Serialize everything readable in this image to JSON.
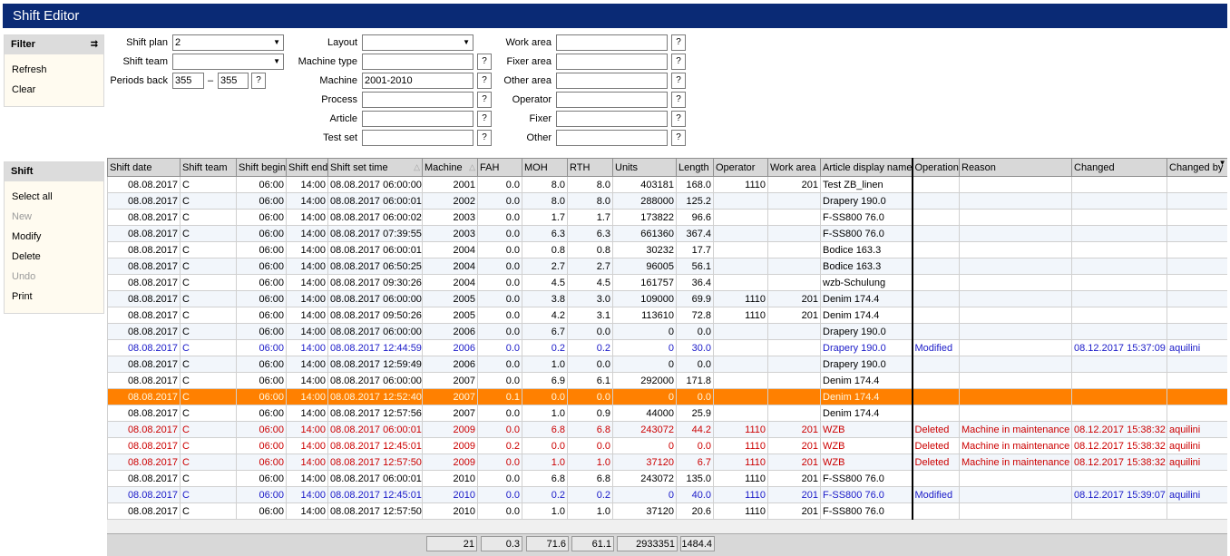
{
  "title": "Shift Editor",
  "filter_panel": {
    "title": "Filter",
    "items": [
      "Refresh",
      "Clear"
    ]
  },
  "shift_panel": {
    "title": "Shift",
    "items": [
      {
        "label": "Select all",
        "enabled": true
      },
      {
        "label": "New",
        "enabled": false
      },
      {
        "label": "Modify",
        "enabled": true
      },
      {
        "label": "Delete",
        "enabled": true
      },
      {
        "label": "Undo",
        "enabled": false
      },
      {
        "label": "Print",
        "enabled": true
      }
    ]
  },
  "filters": {
    "shift_plan": {
      "label": "Shift plan",
      "value": "2"
    },
    "shift_team": {
      "label": "Shift team",
      "value": ""
    },
    "periods_back": {
      "label": "Periods back",
      "from": "355",
      "dash": "–",
      "to": "355"
    },
    "layout": {
      "label": "Layout",
      "value": ""
    },
    "machine_type": {
      "label": "Machine type",
      "value": ""
    },
    "machine": {
      "label": "Machine",
      "value": "2001-2010"
    },
    "process": {
      "label": "Process",
      "value": ""
    },
    "article": {
      "label": "Article",
      "value": ""
    },
    "test_set": {
      "label": "Test set",
      "value": ""
    },
    "work_area": {
      "label": "Work area",
      "value": ""
    },
    "fixer_area": {
      "label": "Fixer area",
      "value": ""
    },
    "other_area": {
      "label": "Other area",
      "value": ""
    },
    "operator": {
      "label": "Operator",
      "value": ""
    },
    "fixer": {
      "label": "Fixer",
      "value": ""
    },
    "other": {
      "label": "Other",
      "value": ""
    },
    "help_button": "?"
  },
  "grid": {
    "columns": [
      "Shift date",
      "Shift team",
      "Shift begin",
      "Shift end",
      "Shift set time",
      "Machine",
      "FAH",
      "MOH",
      "RTH",
      "Units",
      "Length",
      "Operator",
      "Work area",
      "Article display name",
      "Operation",
      "Reason",
      "Changed",
      "Changed by"
    ],
    "sort_indicator": "△",
    "rows": [
      {
        "style": "normal",
        "cells": [
          "08.08.2017",
          "C",
          "06:00",
          "14:00",
          "08.08.2017 06:00:00",
          "2001",
          "0.0",
          "8.0",
          "8.0",
          "403181",
          "168.0",
          "1110",
          "201",
          "Test ZB_linen",
          "",
          "",
          "",
          ""
        ]
      },
      {
        "style": "normal",
        "cells": [
          "08.08.2017",
          "C",
          "06:00",
          "14:00",
          "08.08.2017 06:00:01",
          "2002",
          "0.0",
          "8.0",
          "8.0",
          "288000",
          "125.2",
          "",
          "",
          "Drapery 190.0",
          "",
          "",
          "",
          ""
        ]
      },
      {
        "style": "normal",
        "cells": [
          "08.08.2017",
          "C",
          "06:00",
          "14:00",
          "08.08.2017 06:00:02",
          "2003",
          "0.0",
          "1.7",
          "1.7",
          "173822",
          "96.6",
          "",
          "",
          "F-SS800 76.0",
          "",
          "",
          "",
          ""
        ]
      },
      {
        "style": "normal",
        "cells": [
          "08.08.2017",
          "C",
          "06:00",
          "14:00",
          "08.08.2017 07:39:55",
          "2003",
          "0.0",
          "6.3",
          "6.3",
          "661360",
          "367.4",
          "",
          "",
          "F-SS800 76.0",
          "",
          "",
          "",
          ""
        ]
      },
      {
        "style": "normal",
        "cells": [
          "08.08.2017",
          "C",
          "06:00",
          "14:00",
          "08.08.2017 06:00:01",
          "2004",
          "0.0",
          "0.8",
          "0.8",
          "30232",
          "17.7",
          "",
          "",
          "Bodice 163.3",
          "",
          "",
          "",
          ""
        ]
      },
      {
        "style": "normal",
        "cells": [
          "08.08.2017",
          "C",
          "06:00",
          "14:00",
          "08.08.2017 06:50:25",
          "2004",
          "0.0",
          "2.7",
          "2.7",
          "96005",
          "56.1",
          "",
          "",
          "Bodice 163.3",
          "",
          "",
          "",
          ""
        ]
      },
      {
        "style": "normal",
        "cells": [
          "08.08.2017",
          "C",
          "06:00",
          "14:00",
          "08.08.2017 09:30:26",
          "2004",
          "0.0",
          "4.5",
          "4.5",
          "161757",
          "36.4",
          "",
          "",
          "wzb-Schulung",
          "",
          "",
          "",
          ""
        ]
      },
      {
        "style": "normal",
        "cells": [
          "08.08.2017",
          "C",
          "06:00",
          "14:00",
          "08.08.2017 06:00:00",
          "2005",
          "0.0",
          "3.8",
          "3.0",
          "109000",
          "69.9",
          "1110",
          "201",
          "Denim 174.4",
          "",
          "",
          "",
          ""
        ]
      },
      {
        "style": "normal",
        "cells": [
          "08.08.2017",
          "C",
          "06:00",
          "14:00",
          "08.08.2017 09:50:26",
          "2005",
          "0.0",
          "4.2",
          "3.1",
          "113610",
          "72.8",
          "1110",
          "201",
          "Denim 174.4",
          "",
          "",
          "",
          ""
        ]
      },
      {
        "style": "normal",
        "cells": [
          "08.08.2017",
          "C",
          "06:00",
          "14:00",
          "08.08.2017 06:00:00",
          "2006",
          "0.0",
          "6.7",
          "0.0",
          "0",
          "0.0",
          "",
          "",
          "Drapery 190.0",
          "",
          "",
          "",
          ""
        ]
      },
      {
        "style": "blue",
        "cells": [
          "08.08.2017",
          "C",
          "06:00",
          "14:00",
          "08.08.2017 12:44:59",
          "2006",
          "0.0",
          "0.2",
          "0.2",
          "0",
          "30.0",
          "",
          "",
          "Drapery 190.0",
          "Modified",
          "",
          "08.12.2017 15:37:09",
          "aquilini"
        ]
      },
      {
        "style": "normal",
        "cells": [
          "08.08.2017",
          "C",
          "06:00",
          "14:00",
          "08.08.2017 12:59:49",
          "2006",
          "0.0",
          "1.0",
          "0.0",
          "0",
          "0.0",
          "",
          "",
          "Drapery 190.0",
          "",
          "",
          "",
          ""
        ]
      },
      {
        "style": "normal",
        "cells": [
          "08.08.2017",
          "C",
          "06:00",
          "14:00",
          "08.08.2017 06:00:00",
          "2007",
          "0.0",
          "6.9",
          "6.1",
          "292000",
          "171.8",
          "",
          "",
          "Denim 174.4",
          "",
          "",
          "",
          ""
        ]
      },
      {
        "style": "sel",
        "cells": [
          "08.08.2017",
          "C",
          "06:00",
          "14:00",
          "08.08.2017 12:52:40",
          "2007",
          "0.1",
          "0.0",
          "0.0",
          "0",
          "0.0",
          "",
          "",
          "Denim 174.4",
          "",
          "",
          "",
          ""
        ]
      },
      {
        "style": "normal",
        "cells": [
          "08.08.2017",
          "C",
          "06:00",
          "14:00",
          "08.08.2017 12:57:56",
          "2007",
          "0.0",
          "1.0",
          "0.9",
          "44000",
          "25.9",
          "",
          "",
          "Denim 174.4",
          "",
          "",
          "",
          ""
        ]
      },
      {
        "style": "red",
        "cells": [
          "08.08.2017",
          "C",
          "06:00",
          "14:00",
          "08.08.2017 06:00:01",
          "2009",
          "0.0",
          "6.8",
          "6.8",
          "243072",
          "44.2",
          "1110",
          "201",
          "WZB",
          "Deleted",
          "Machine in maintenance",
          "08.12.2017 15:38:32",
          "aquilini"
        ]
      },
      {
        "style": "red",
        "cells": [
          "08.08.2017",
          "C",
          "06:00",
          "14:00",
          "08.08.2017 12:45:01",
          "2009",
          "0.2",
          "0.0",
          "0.0",
          "0",
          "0.0",
          "1110",
          "201",
          "WZB",
          "Deleted",
          "Machine in maintenance",
          "08.12.2017 15:38:32",
          "aquilini"
        ]
      },
      {
        "style": "red",
        "cells": [
          "08.08.2017",
          "C",
          "06:00",
          "14:00",
          "08.08.2017 12:57:50",
          "2009",
          "0.0",
          "1.0",
          "1.0",
          "37120",
          "6.7",
          "1110",
          "201",
          "WZB",
          "Deleted",
          "Machine in maintenance",
          "08.12.2017 15:38:32",
          "aquilini"
        ]
      },
      {
        "style": "normal",
        "cells": [
          "08.08.2017",
          "C",
          "06:00",
          "14:00",
          "08.08.2017 06:00:01",
          "2010",
          "0.0",
          "6.8",
          "6.8",
          "243072",
          "135.0",
          "1110",
          "201",
          "F-SS800 76.0",
          "",
          "",
          "",
          ""
        ]
      },
      {
        "style": "blue",
        "cells": [
          "08.08.2017",
          "C",
          "06:00",
          "14:00",
          "08.08.2017 12:45:01",
          "2010",
          "0.0",
          "0.2",
          "0.2",
          "0",
          "40.0",
          "1110",
          "201",
          "F-SS800 76.0",
          "Modified",
          "",
          "08.12.2017 15:39:07",
          "aquilini"
        ]
      },
      {
        "style": "normal",
        "cells": [
          "08.08.2017",
          "C",
          "06:00",
          "14:00",
          "08.08.2017 12:57:50",
          "2010",
          "0.0",
          "1.0",
          "1.0",
          "37120",
          "20.6",
          "1110",
          "201",
          "F-SS800 76.0",
          "",
          "",
          "",
          ""
        ]
      }
    ],
    "totals": {
      "machine": "21",
      "fah": "0.3",
      "moh": "71.6",
      "rth": "61.1",
      "units": "2933351",
      "length": "1484.4"
    }
  },
  "colors": {
    "titlebar": "#0a2a75",
    "selected_row": "#ff8000",
    "modified": "#1a1ac8",
    "deleted": "#cc0000"
  }
}
